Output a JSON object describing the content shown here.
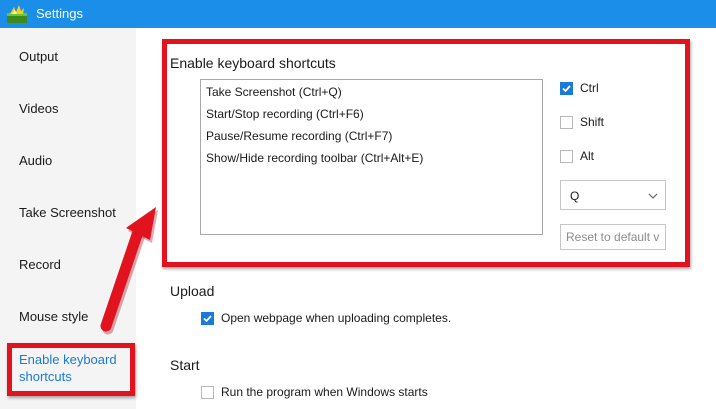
{
  "window": {
    "title": "Settings"
  },
  "sidebar": {
    "items": [
      {
        "label": "Output"
      },
      {
        "label": "Videos"
      },
      {
        "label": "Audio"
      },
      {
        "label": "Take Screenshot"
      },
      {
        "label": "Record"
      },
      {
        "label": "Mouse style"
      },
      {
        "label_line1": "Enable keyboard",
        "label_line2": "shortcuts",
        "active": true
      }
    ]
  },
  "shortcuts": {
    "title": "Enable keyboard shortcuts",
    "list": [
      "Take Screenshot (Ctrl+Q)",
      "Start/Stop recording (Ctrl+F6)",
      "Pause/Resume recording (Ctrl+F7)",
      "Show/Hide recording toolbar (Ctrl+Alt+E)"
    ],
    "modifiers": [
      {
        "label": "Ctrl",
        "checked": true
      },
      {
        "label": "Shift",
        "checked": false
      },
      {
        "label": "Alt",
        "checked": false
      }
    ],
    "key_select": {
      "value": "Q"
    },
    "reset_label": "Reset to default v"
  },
  "upload": {
    "title": "Upload",
    "option": {
      "label": "Open webpage when uploading completes.",
      "checked": true
    }
  },
  "start": {
    "title": "Start",
    "option": {
      "label": "Run the program when Windows starts",
      "checked": false
    }
  },
  "colors": {
    "titlebar": "#1a8ee8",
    "accent": "#1a7ad9",
    "highlight": "#e0131f",
    "sidebar_bg": "#f4f4f4"
  },
  "icons": {
    "app": "app-logo-icon",
    "check": "checkmark-icon",
    "dropdown": "chevron-down-icon"
  }
}
